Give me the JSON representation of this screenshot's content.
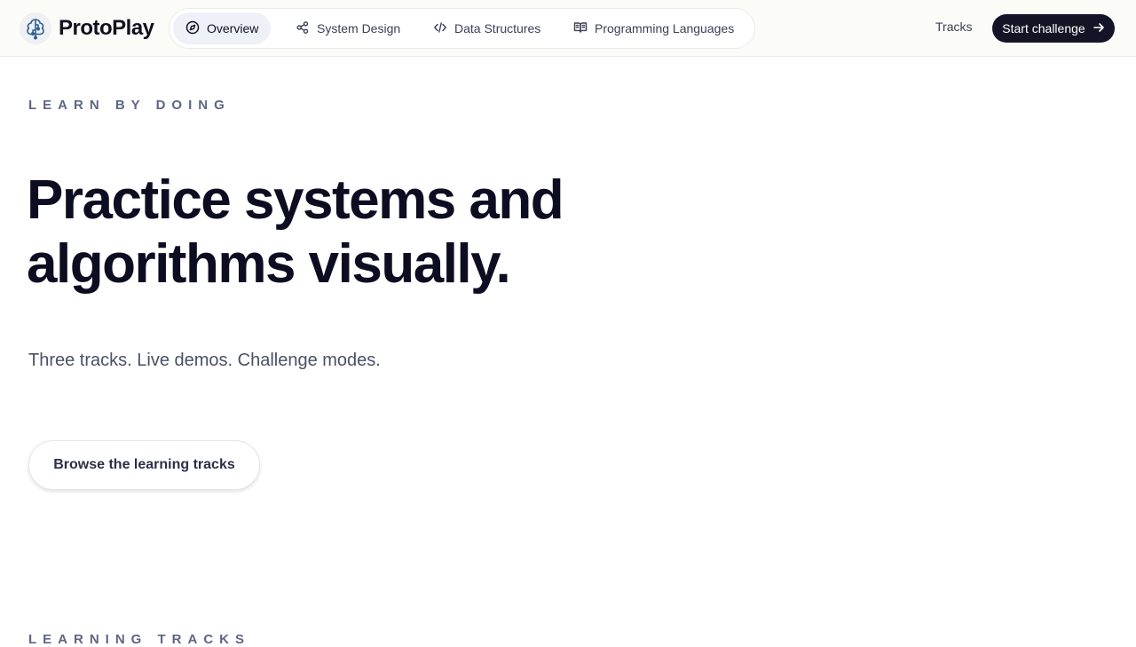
{
  "brand": {
    "name": "ProtoPlay",
    "logo_icon": "brain-circuit-icon"
  },
  "nav": {
    "items": [
      {
        "label": "Overview",
        "icon": "compass-icon",
        "active": true
      },
      {
        "label": "System Design",
        "icon": "share-nodes-icon",
        "active": false
      },
      {
        "label": "Data Structures",
        "icon": "code-icon",
        "active": false
      },
      {
        "label": "Programming Languages",
        "icon": "open-book-icon",
        "active": false
      }
    ]
  },
  "header": {
    "tracks_label": "Tracks",
    "cta_label": "Start challenge",
    "cta_icon": "arrow-right-icon"
  },
  "hero": {
    "eyebrow": "LEARN BY DOING",
    "headline_line1": "Practice systems and",
    "headline_line2": "algorithms visually.",
    "subline": "Three tracks. Live demos. Challenge modes.",
    "browse_label": "Browse the learning tracks"
  },
  "section": {
    "label": "LEARNING TRACKS"
  },
  "colors": {
    "ink": "#0d0d22",
    "cta_bg": "#141426",
    "active_nav_bg": "#eef1f8",
    "header_bg": "#fbfbf7",
    "muted": "#5e6682"
  }
}
